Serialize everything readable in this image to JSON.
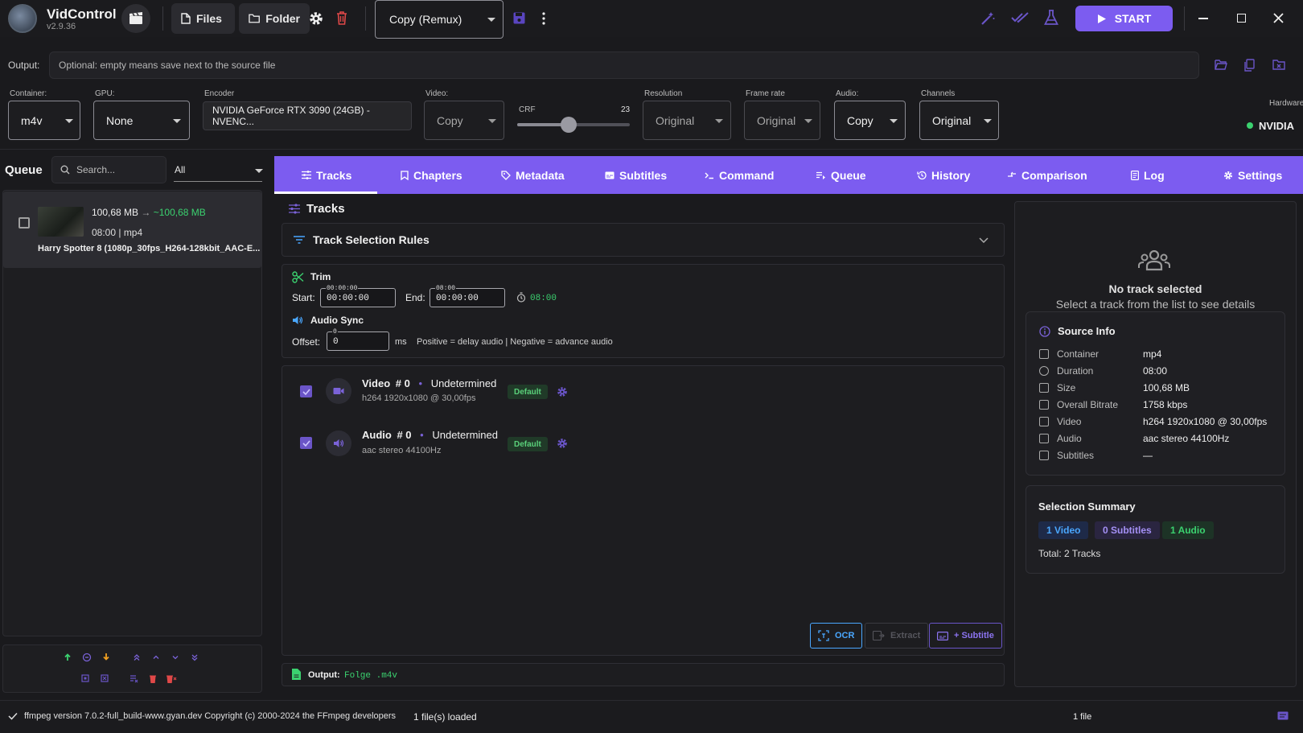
{
  "app": {
    "title": "VidControl",
    "version": "v2.9.36"
  },
  "toolbar": {
    "files_label": "Files",
    "folder_label": "Folder",
    "preset_value": "Copy (Remux)",
    "start_label": "START"
  },
  "output": {
    "label": "Output:",
    "placeholder": "Optional: empty means save next to the source file"
  },
  "settings": {
    "container_label": "Container:",
    "container_value": "m4v",
    "gpu_label": "GPU:",
    "gpu_value": "None",
    "encoder_label": "Encoder",
    "encoder_value": "NVIDIA GeForce RTX 3090 (24GB) - NVENC...",
    "video_label": "Video:",
    "video_value": "Copy",
    "crf_label": "CRF",
    "crf_value": "23",
    "crf_level": 0.46,
    "resolution_label": "Resolution",
    "resolution_value": "Original",
    "framerate_label": "Frame rate",
    "framerate_value": "Original",
    "audio_label": "Audio:",
    "audio_value": "Copy",
    "channels_label": "Channels",
    "channels_value": "Original",
    "hardware_label": "Hardware",
    "hardware_value": "NVIDIA",
    "hardware_status_color": "#3bd16f"
  },
  "queue": {
    "title": "Queue",
    "search_placeholder": "Search...",
    "filter_value": "All",
    "items": [
      {
        "size": "100,68 MB",
        "arrow": "→",
        "est_size": "~100,68 MB",
        "meta": "08:00 | mp4",
        "name": "Harry Spotter 8 (1080p_30fps_H264-128kbit_AAC-E..."
      }
    ]
  },
  "tabs": [
    {
      "label": "Tracks",
      "icon": "tracks-icon",
      "active": true
    },
    {
      "label": "Chapters",
      "icon": "bookmark-icon"
    },
    {
      "label": "Metadata",
      "icon": "tag-icon"
    },
    {
      "label": "Subtitles",
      "icon": "subtitles-icon"
    },
    {
      "label": "Command",
      "icon": "terminal-icon"
    },
    {
      "label": "Queue",
      "icon": "queue-icon"
    },
    {
      "label": "History",
      "icon": "history-icon"
    },
    {
      "label": "Comparison",
      "icon": "comparison-icon"
    },
    {
      "label": "Log",
      "icon": "log-icon"
    },
    {
      "label": "Settings",
      "icon": "gear-icon"
    }
  ],
  "tracks": {
    "title": "Tracks",
    "rules_title": "Track Selection Rules",
    "trim": {
      "title": "Trim",
      "start_label": "Start:",
      "start_value": "00:00:00",
      "start_hint": "00:00:00",
      "end_label": "End:",
      "end_value": "00:00:00",
      "end_hint": "08:00",
      "duration": "08:00"
    },
    "audio_sync": {
      "title": "Audio Sync",
      "offset_label": "Offset:",
      "offset_value": "0",
      "offset_hint": "0",
      "unit": "ms",
      "hint": "Positive = delay audio | Negative = advance audio"
    },
    "list": [
      {
        "kind": "Video",
        "index": "# 0",
        "dot": "•",
        "lang": "Undetermined",
        "detail": "h264 1920x1080 @ 30,00fps",
        "badge": "Default"
      },
      {
        "kind": "Audio",
        "index": "# 0",
        "dot": "•",
        "lang": "Undetermined",
        "detail": "aac stereo 44100Hz",
        "badge": "Default"
      }
    ],
    "ocr_label": "OCR",
    "extract_label": "Extract",
    "add_subtitle_label": "+ Subtitle",
    "output_label": "Output:",
    "output_value": "Folge .m4v"
  },
  "details": {
    "empty_title": "No track selected",
    "empty_sub": "Select a track from the list to see details",
    "source_title": "Source Info",
    "rows": [
      {
        "label": "Container",
        "value": "mp4",
        "icon": "box-icon"
      },
      {
        "label": "Duration",
        "value": "08:00",
        "icon": "clock-icon"
      },
      {
        "label": "Size",
        "value": "100,68 MB",
        "icon": "disk-icon"
      },
      {
        "label": "Overall Bitrate",
        "value": "1758 kbps",
        "icon": "chart-icon"
      },
      {
        "label": "Video",
        "value": "h264 1920x1080 @ 30,00fps",
        "icon": "video-icon"
      },
      {
        "label": "Audio",
        "value": "aac stereo 44100Hz",
        "icon": "speaker-icon"
      },
      {
        "label": "Subtitles",
        "value": "—",
        "icon": "subtitles-icon"
      }
    ],
    "summary_title": "Selection Summary",
    "pills": [
      "1 Video",
      "0 Subtitles",
      "1 Audio"
    ],
    "total": "Total: 2 Tracks"
  },
  "status": {
    "ffmpeg": "ffmpeg version 7.0.2-full_build-www.gyan.dev Copyright (c) 2000-2024 the FFmpeg developers",
    "loaded": "1 file(s) loaded",
    "count": "1 file"
  },
  "colors": {
    "accent": "#7c5cf0",
    "green": "#3bd16f",
    "danger": "#e04848",
    "blue": "#4aa7ff"
  }
}
